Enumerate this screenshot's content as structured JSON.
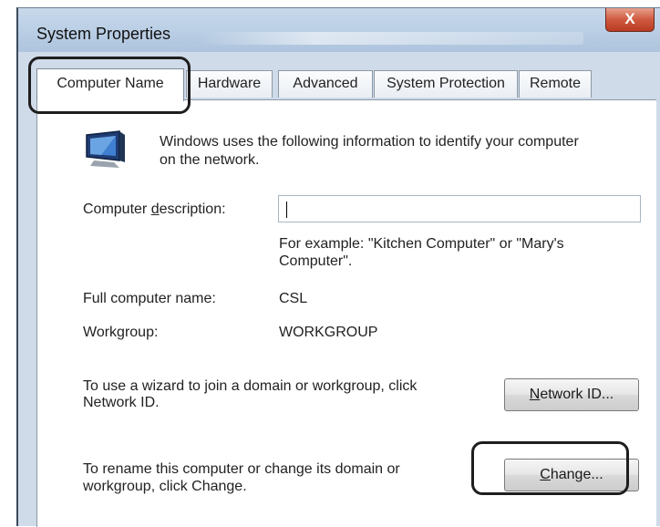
{
  "window": {
    "title": "System Properties",
    "close_label": "X"
  },
  "tabs": [
    {
      "label": "Computer Name",
      "active": true
    },
    {
      "label": "Hardware",
      "active": false
    },
    {
      "label": "Advanced",
      "active": false
    },
    {
      "label": "System Protection",
      "active": false
    },
    {
      "label": "Remote",
      "active": false
    }
  ],
  "icons": {
    "header_icon": "computer-monitor-icon"
  },
  "computer_name_tab": {
    "intro_text_line1": "Windows uses the following information to identify your computer",
    "intro_text_line2": "on the network.",
    "description_label_pre": "Computer ",
    "description_label_accel": "d",
    "description_label_post": "escription:",
    "description_value": "",
    "example_line1": "For example: \"Kitchen Computer\" or \"Mary's",
    "example_line2": "Computer\".",
    "full_name_label": "Full computer name:",
    "full_name_value": "CSL",
    "workgroup_label": "Workgroup:",
    "workgroup_value": "WORKGROUP",
    "wizard_text_line1": "To use a wizard to join a domain or workgroup, click",
    "wizard_text_line2": "Network ID.",
    "network_id_button_accel": "N",
    "network_id_button_rest": "etwork ID...",
    "rename_text_line1": "To rename this computer or change its domain or",
    "rename_text_line2": "workgroup, click Change.",
    "change_button_accel": "C",
    "change_button_rest": "hange..."
  }
}
